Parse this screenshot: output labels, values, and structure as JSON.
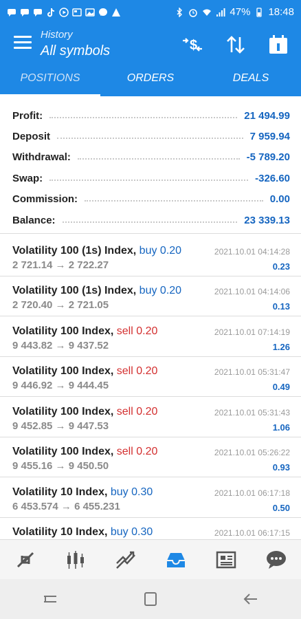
{
  "status_bar": {
    "left_icons": [
      "message-icon",
      "message-icon",
      "message-icon",
      "tiktok-icon",
      "play-icon",
      "news-icon",
      "gallery-icon",
      "messenger-icon",
      "warning-icon"
    ],
    "battery": "47%",
    "time": "18:48"
  },
  "app_bar": {
    "subtitle": "History",
    "title": "All symbols",
    "color": "#1e88e5"
  },
  "tabs": [
    {
      "label": "POSITIONS",
      "active": true
    },
    {
      "label": "ORDERS",
      "active": false
    },
    {
      "label": "DEALS",
      "active": false
    }
  ],
  "summary": [
    {
      "label": "Profit:",
      "value": "21 494.99"
    },
    {
      "label": "Deposit",
      "value": "7 959.94"
    },
    {
      "label": "Withdrawal:",
      "value": "-5 789.20"
    },
    {
      "label": "Swap:",
      "value": "-326.60"
    },
    {
      "label": "Commission:",
      "value": "0.00"
    },
    {
      "label": "Balance:",
      "value": "23 339.13"
    }
  ],
  "deals": [
    {
      "symbol": "Volatility 100 (1s) Index,",
      "side": "buy 0.20",
      "type": "buy",
      "prices": "2 721.14 → 2 722.27",
      "time": "2021.10.01 04:14:28",
      "profit": "0.23"
    },
    {
      "symbol": "Volatility 100 (1s) Index,",
      "side": "buy 0.20",
      "type": "buy",
      "prices": "2 720.40 → 2 721.05",
      "time": "2021.10.01 04:14:06",
      "profit": "0.13"
    },
    {
      "symbol": "Volatility 100 Index,",
      "side": "sell 0.20",
      "type": "sell",
      "prices": "9 443.82 → 9 437.52",
      "time": "2021.10.01 07:14:19",
      "profit": "1.26"
    },
    {
      "symbol": "Volatility 100 Index,",
      "side": "sell 0.20",
      "type": "sell",
      "prices": "9 446.92 → 9 444.45",
      "time": "2021.10.01 05:31:47",
      "profit": "0.49"
    },
    {
      "symbol": "Volatility 100 Index,",
      "side": "sell 0.20",
      "type": "sell",
      "prices": "9 452.85 → 9 447.53",
      "time": "2021.10.01 05:31:43",
      "profit": "1.06"
    },
    {
      "symbol": "Volatility 100 Index,",
      "side": "sell 0.20",
      "type": "sell",
      "prices": "9 455.16 → 9 450.50",
      "time": "2021.10.01 05:26:22",
      "profit": "0.93"
    },
    {
      "symbol": "Volatility 10 Index,",
      "side": "buy 0.30",
      "type": "buy",
      "prices": "6 453.574 → 6 455.231",
      "time": "2021.10.01 06:17:18",
      "profit": "0.50"
    },
    {
      "symbol": "Volatility 10 Index,",
      "side": "buy 0.30",
      "type": "buy",
      "prices": "",
      "time": "2021.10.01 06:17:15",
      "profit": ""
    }
  ],
  "bottom_nav": [
    "quotes-icon",
    "chart-icon",
    "trade-icon",
    "history-icon",
    "news-icon",
    "chat-icon"
  ],
  "bottom_nav_active": "history-icon",
  "colors": {
    "accent": "#1e88e5",
    "buy": "#1565c0",
    "sell": "#d32f2f"
  }
}
